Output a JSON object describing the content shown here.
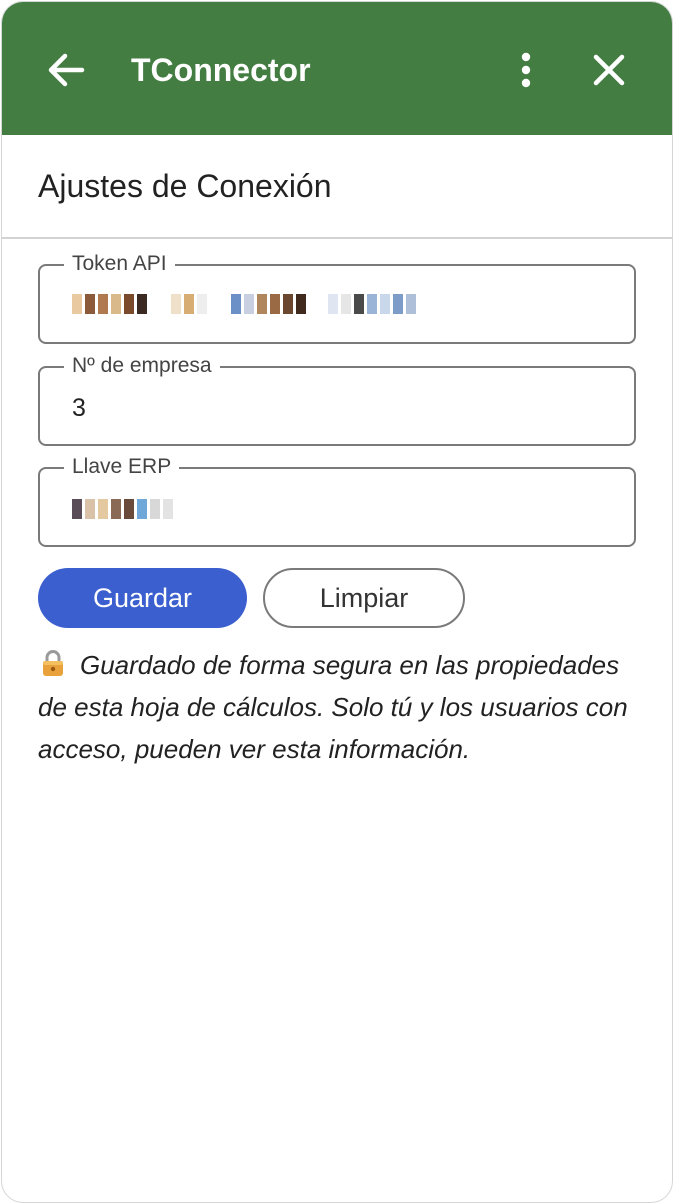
{
  "header": {
    "title": "TConnector",
    "back_icon": "arrow-left-icon",
    "more_icon": "more-vertical-icon",
    "close_icon": "close-icon",
    "background_color": "#437d42"
  },
  "section": {
    "title": "Ajustes de Conexión"
  },
  "fields": [
    {
      "label": "Token API",
      "value_masked": true
    },
    {
      "label": "Nº de empresa",
      "value": "3"
    },
    {
      "label": "Llave ERP",
      "value_masked": true
    }
  ],
  "actions": {
    "save_label": "Guardar",
    "clear_label": "Limpiar",
    "primary_color": "#3b5fcf"
  },
  "note": {
    "icon": "lock-icon",
    "text": "Guardado de forma segura en las propiedades de esta hoja de cálculos. Solo tú y los usuarios con acceso, pueden ver esta información."
  }
}
